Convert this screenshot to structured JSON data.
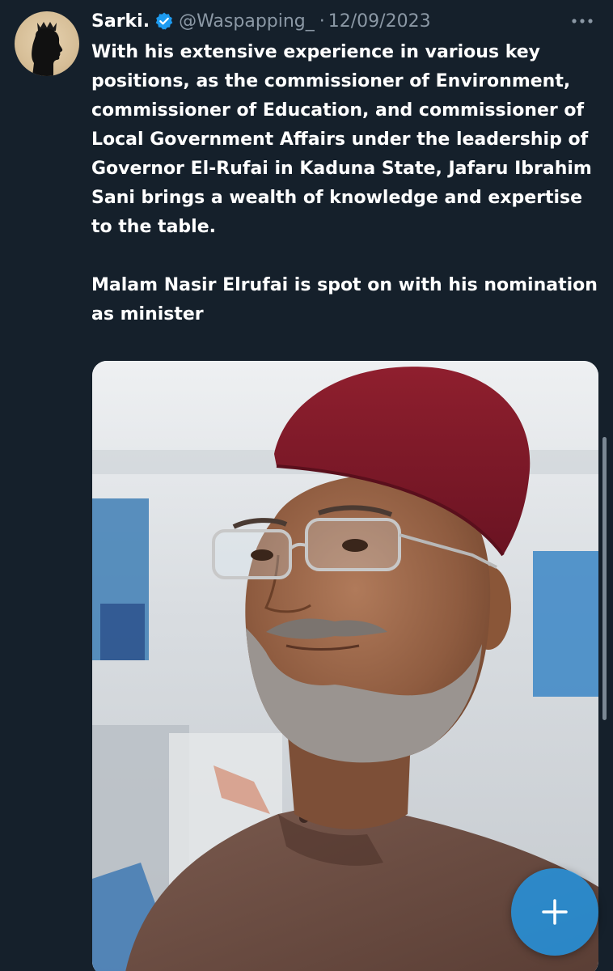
{
  "tweet": {
    "author": {
      "display_name": "Sarki.",
      "handle": "@Waspapping_",
      "verified": true
    },
    "separator": "·",
    "date": "12/09/2023",
    "paragraphs": [
      "With his extensive experience in various key positions, as the commissioner of Environment, commissioner of Education, and commissioner of Local Government Affairs under the leadership of Governor El-Rufai in Kaduna State, Jafaru Ibrahim Sani brings a wealth of knowledge and expertise to the table.",
      "Malam Nasir Elrufai is spot on with his nomination as minister"
    ]
  },
  "icons": {
    "verified": "verified-badge-icon",
    "more": "more-options-icon",
    "compose": "plus-icon"
  },
  "colors": {
    "background": "#15202b",
    "text_primary": "#ffffff",
    "text_secondary": "#8b98a5",
    "accent": "#1d9bf0"
  }
}
